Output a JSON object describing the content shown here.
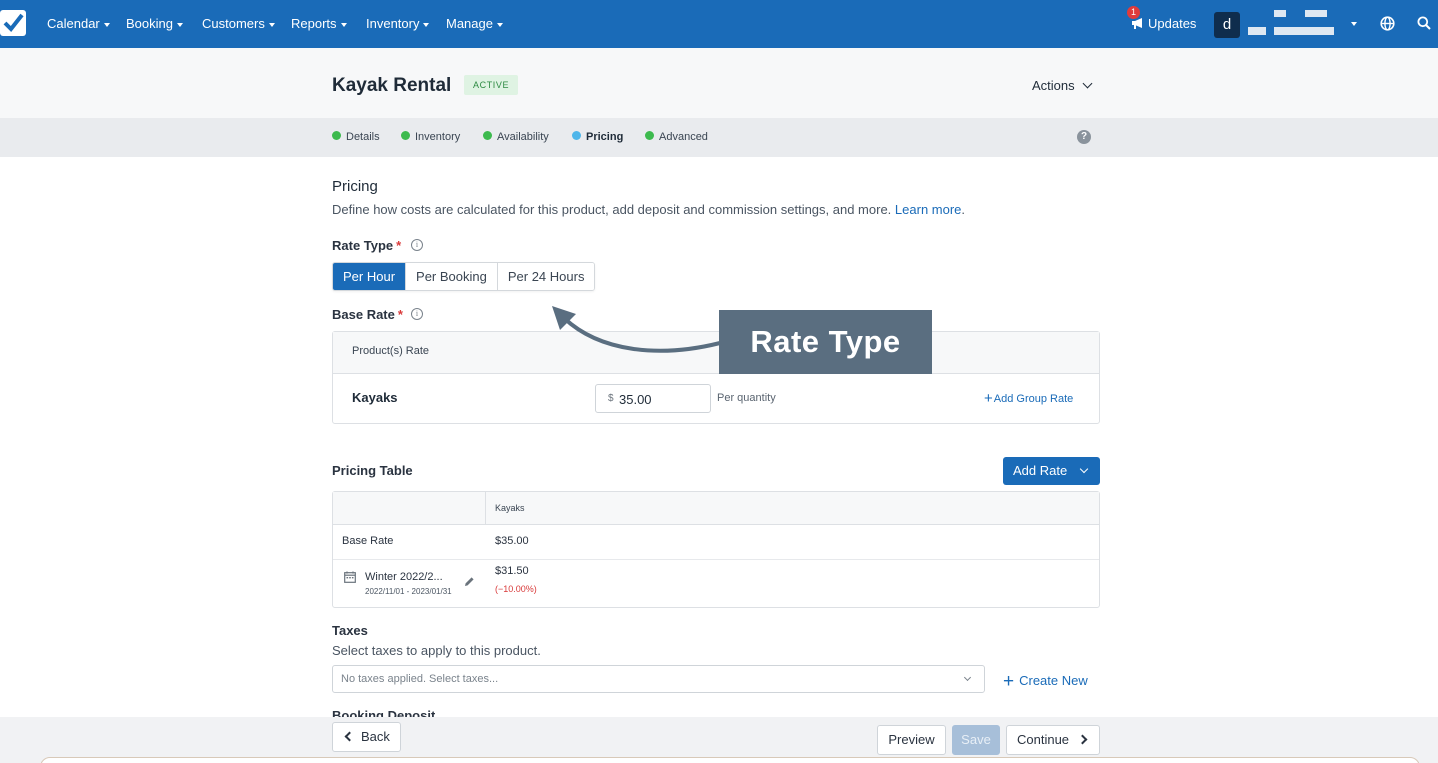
{
  "nav": {
    "items": [
      {
        "label": "Calendar"
      },
      {
        "label": "Booking"
      },
      {
        "label": "Customers"
      },
      {
        "label": "Reports"
      },
      {
        "label": "Inventory"
      },
      {
        "label": "Manage"
      }
    ],
    "updates_label": "Updates",
    "updates_count": "1",
    "avatar_initial": "d"
  },
  "header": {
    "title": "Kayak Rental",
    "status": "ACTIVE",
    "actions_label": "Actions"
  },
  "steps": [
    {
      "label": "Details",
      "color": "#3dba4e"
    },
    {
      "label": "Inventory",
      "color": "#3dba4e"
    },
    {
      "label": "Availability",
      "color": "#3dba4e"
    },
    {
      "label": "Pricing",
      "color": "#4fb6ea"
    },
    {
      "label": "Advanced",
      "color": "#3dba4e"
    }
  ],
  "help_icon_text": "?",
  "pricing": {
    "title": "Pricing",
    "description": "Define how costs are calculated for this product, add deposit and commission settings, and more.",
    "learn_more": "Learn more",
    "period": ".",
    "rate_type_label": "Rate Type",
    "required_mark": "*",
    "info_glyph": "i",
    "rate_types": [
      "Per Hour",
      "Per Booking",
      "Per 24 Hours"
    ],
    "base_rate_label": "Base Rate",
    "products_rate_header": "Product(s) Rate",
    "product_name": "Kayaks",
    "currency_symbol": "$",
    "base_rate_value": "35.00",
    "per_quantity": "Per quantity",
    "add_group_rate": "Add Group Rate"
  },
  "annotation": {
    "text": "Rate Type"
  },
  "pricing_table": {
    "title": "Pricing Table",
    "add_rate_label": "Add Rate",
    "column_header": "Kayaks",
    "rows": [
      {
        "name": "Base Rate",
        "value": "$35.00"
      },
      {
        "name": "Winter 2022/2...",
        "dates": "2022/11/01 - 2023/01/31",
        "value": "$31.50",
        "change": "(−10.00%)"
      }
    ]
  },
  "taxes": {
    "title": "Taxes",
    "description": "Select taxes to apply to this product.",
    "placeholder": "No taxes applied. Select taxes...",
    "create_new": "Create New"
  },
  "booking_deposit_label": "Booking Deposit",
  "footer": {
    "back": "Back",
    "preview": "Preview",
    "save": "Save",
    "continue": "Continue"
  },
  "colors": {
    "nav_bg": "#1a6bb8",
    "primary": "#1a6bb8",
    "complete_step": "#3dba4e",
    "current_step": "#4fb6ea",
    "annotation_bg": "#5a6e80"
  }
}
